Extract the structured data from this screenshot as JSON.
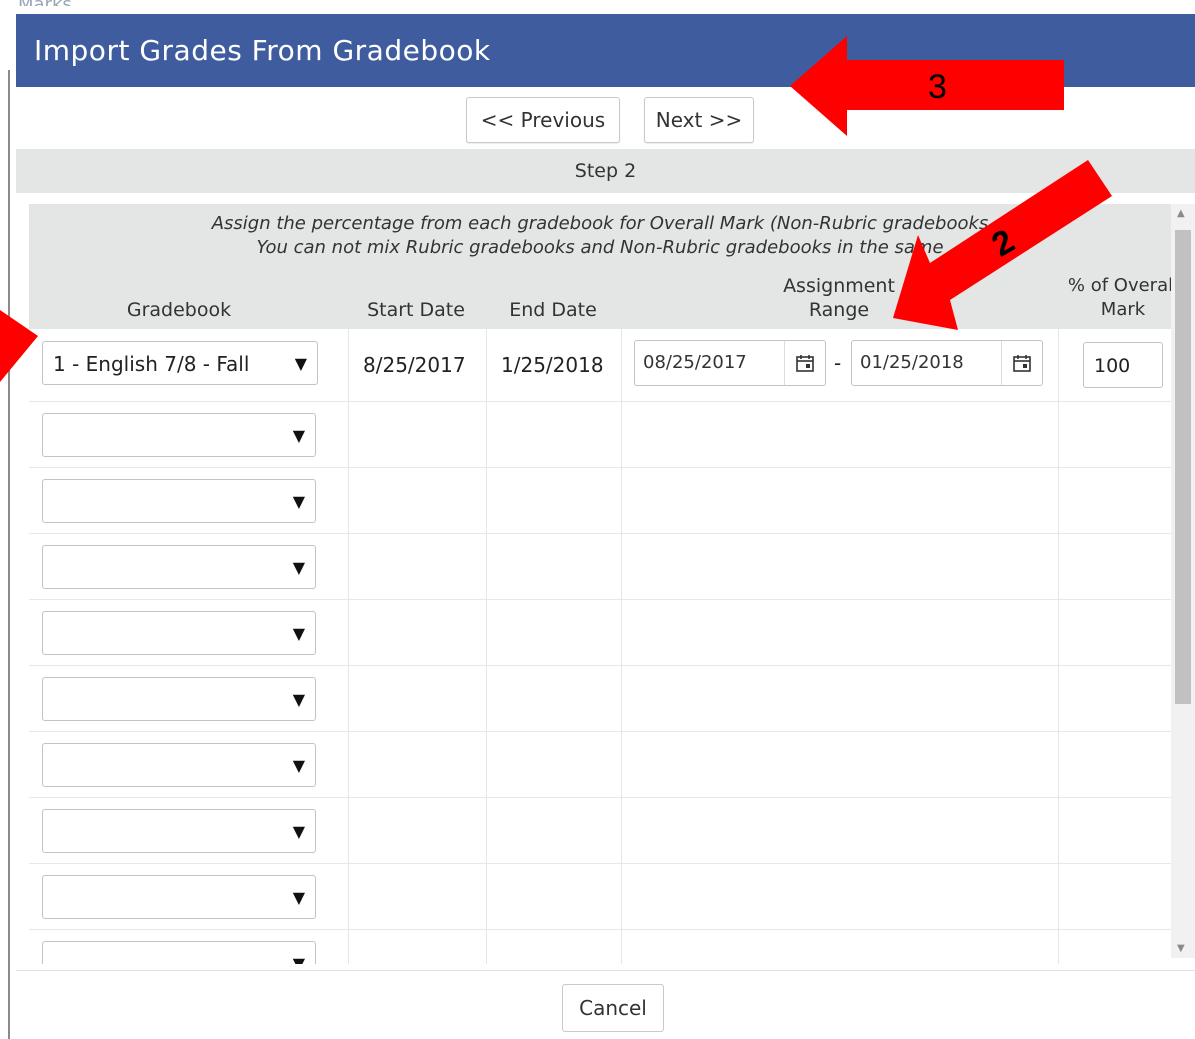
{
  "background": {
    "title_fragment": "Marks"
  },
  "modal": {
    "title": "Import Grades From Gradebook",
    "prev_label": "<< Previous",
    "next_label": "Next >>",
    "step": "Step 2",
    "cancel_label": "Cancel"
  },
  "instructions": {
    "line1": "Assign the percentage from each gradebook for Overall Mark (Non-Rubric gradebooks",
    "line2": "You can not mix Rubric gradebooks and Non-Rubric gradebooks in the same"
  },
  "columns": {
    "gradebook": "Gradebook",
    "start_date": "Start Date",
    "end_date": "End Date",
    "range_line1": "Assignment",
    "range_line2": "Range",
    "pct_line1": "% of Overall",
    "pct_line2": "Mark"
  },
  "rows": [
    {
      "gradebook": "1 - English 7/8 - Fall",
      "start_date": "8/25/2017",
      "end_date": "1/25/2018",
      "range_start": "08/25/2017",
      "range_end": "01/25/2018",
      "percent": "100"
    }
  ],
  "empty_rows": 9,
  "annotations": {
    "arrow_2": "2",
    "arrow_3": "3",
    "arrow_color": "#ff0000"
  },
  "colors": {
    "header_bg": "#3f5d9e",
    "band_bg": "#e4e5e5"
  }
}
